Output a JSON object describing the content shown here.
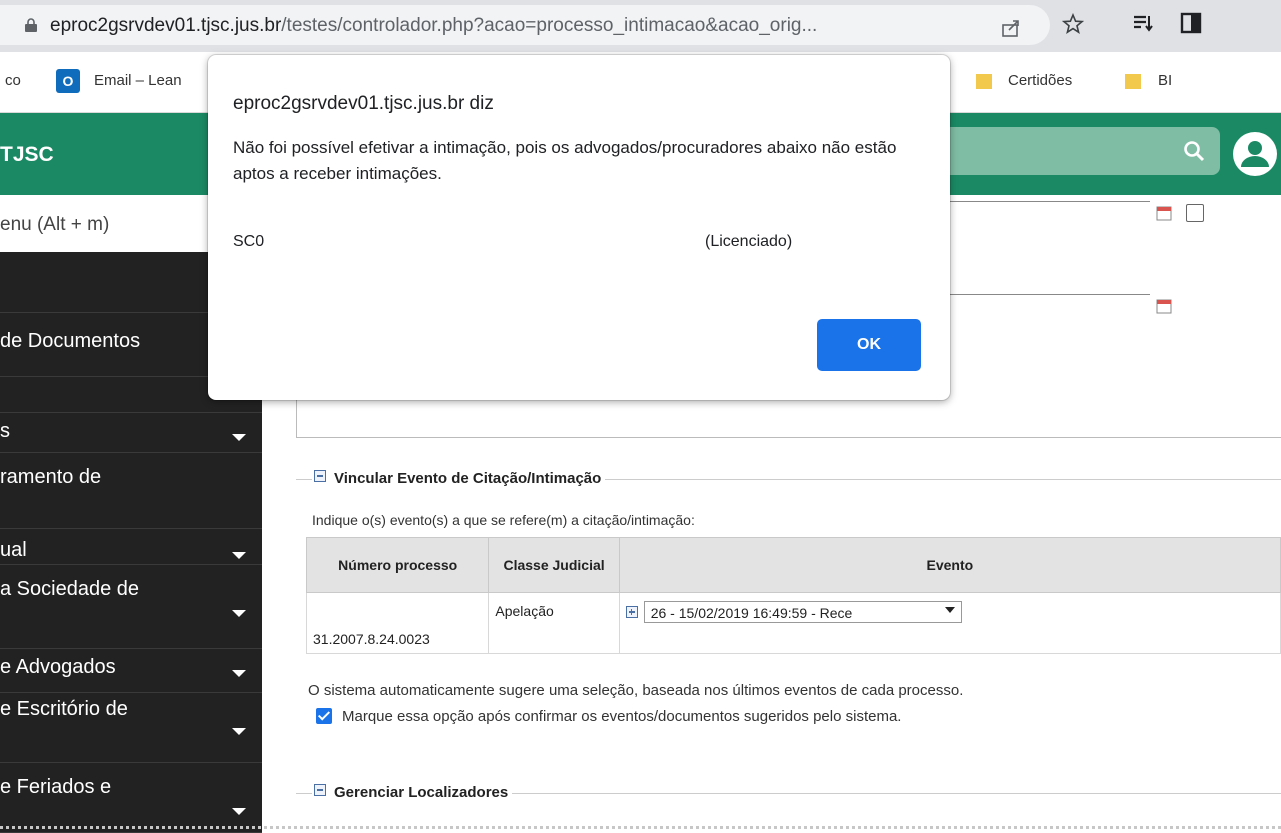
{
  "browser": {
    "url_host": "eproc2gsrvdev01.tjsc.jus.br",
    "url_path": "/testes/controlador.php?acao=processo_intimacao&acao_orig..."
  },
  "bookmarks": {
    "items": [
      {
        "label": "co"
      },
      {
        "label": "Email – Lean"
      },
      {
        "label": "Certidões"
      },
      {
        "label": "BI"
      }
    ],
    "outlook_letter": "O"
  },
  "header": {
    "title": "TJSC"
  },
  "sidebar": {
    "menu_search_placeholder": "enu (Alt + m)",
    "items": [
      {
        "label": "de Documentos"
      },
      {
        "label": "s"
      },
      {
        "label": "ramento de"
      },
      {
        "label": "ual"
      },
      {
        "label": "a Sociedade de"
      },
      {
        "label": "e Advogados"
      },
      {
        "label": "e Escritório de"
      },
      {
        "label": "e Feriados e"
      }
    ]
  },
  "dialog": {
    "title": "eproc2gsrvdev01.tjsc.jus.br diz",
    "message": "Não foi possível efetivar a intimação, pois os advogados/procuradores abaixo não estão aptos a receber intimações.",
    "code": "SC0",
    "status": "(Licenciado)",
    "ok_label": "OK"
  },
  "vincular": {
    "legend": "Vincular Evento de Citação/Intimação",
    "hint": "Indique o(s) evento(s) a que se refere(m) a citação/intimação:",
    "columns": [
      "Número processo",
      "Classe Judicial",
      "Evento"
    ],
    "rows": [
      {
        "numero": "31.2007.8.24.0023",
        "classe": "Apelação",
        "evento": "26 - 15/02/2019 16:49:59 - Rece"
      }
    ],
    "auto_text": "O sistema automaticamente sugere uma seleção, baseada nos últimos eventos de cada processo.",
    "confirm_label": "Marque essa opção após confirmar os eventos/documentos sugeridos pelo sistema."
  },
  "localizadores": {
    "legend": "Gerenciar Localizadores"
  },
  "colors": {
    "header": "#1b8a64",
    "sidebar": "#222222",
    "button_blue": "#1a73e8"
  }
}
